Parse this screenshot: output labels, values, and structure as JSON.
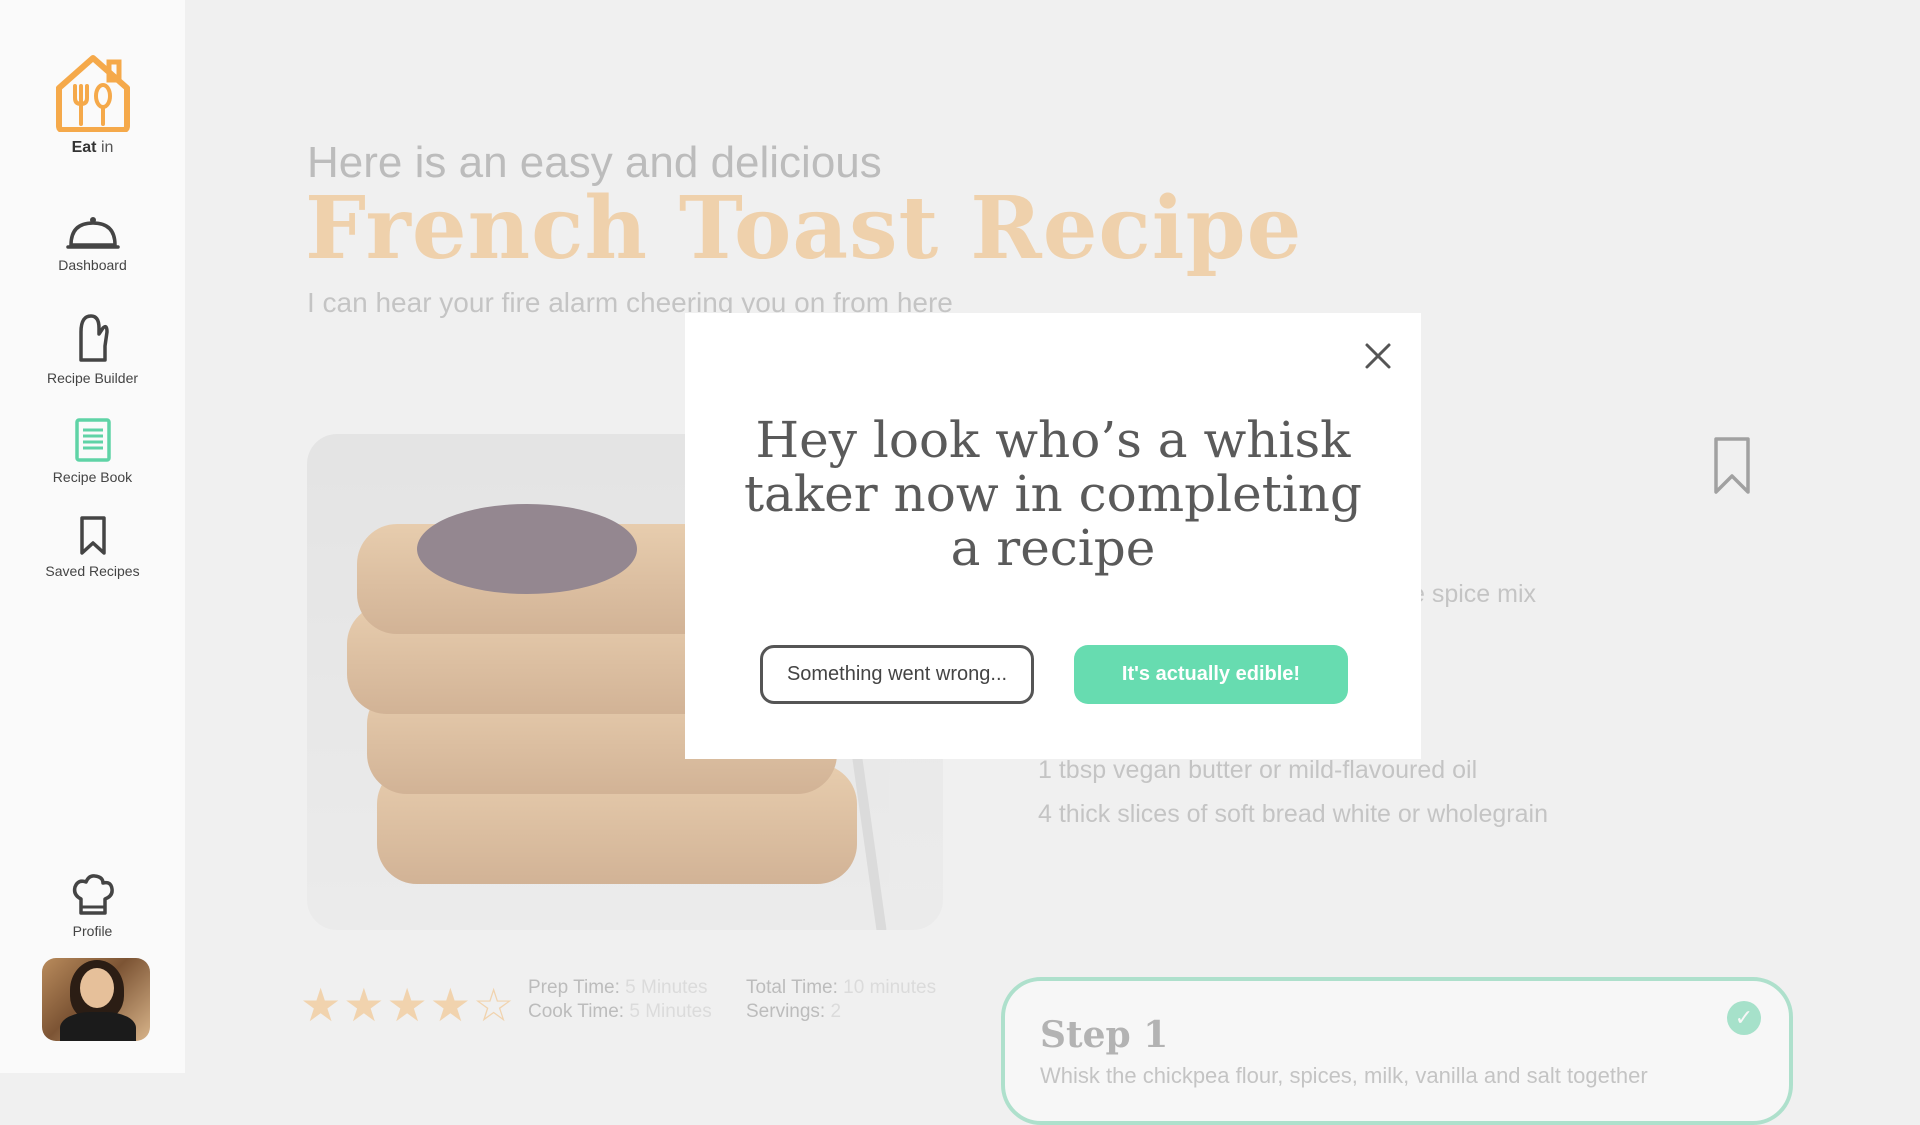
{
  "sidebar": {
    "logo": {
      "brand_bold": "Eat",
      "brand_rest": " in"
    },
    "items": [
      {
        "label": "Dashboard",
        "icon": "cloche-icon"
      },
      {
        "label": "Recipe Builder",
        "icon": "oven-mitt-icon"
      },
      {
        "label": "Recipe Book",
        "icon": "recipe-book-icon"
      },
      {
        "label": "Saved Recipes",
        "icon": "bookmark-icon"
      }
    ],
    "profile": {
      "label": "Profile",
      "icon": "chef-hat-icon"
    }
  },
  "recipe": {
    "kicker": "Here is an easy and delicious",
    "title": "French Toast Recipe",
    "subtitle": "I can hear your fire alarm cheering you on from here",
    "ingredients_visible": [
      "e spice mix",
      "1 tbsp vegan butter or mild-flavoured oil",
      "4 thick slices of soft bread white or wholegrain"
    ],
    "rating": {
      "stars_filled": 4,
      "stars_total": 5
    },
    "meta": {
      "prep_label": "Prep Time:",
      "prep_value": "5 Minutes",
      "cook_label": "Cook Time:",
      "cook_value": "5 Minutes",
      "total_label": "Total Time:",
      "total_value": "10 minutes",
      "servings_label": "Servings:",
      "servings_value": "2"
    },
    "step": {
      "title": "Step 1",
      "text": "Whisk the chickpea flour, spices, milk, vanilla and salt together"
    }
  },
  "modal": {
    "title": "Hey look who’s a whisk taker now in completing a recipe",
    "secondary_label": "Something went wrong...",
    "primary_label": "It's actually edible!"
  },
  "colors": {
    "accent_orange": "#f5a94a",
    "accent_green": "#67dcb0",
    "text_dark": "#5a5a5a"
  }
}
